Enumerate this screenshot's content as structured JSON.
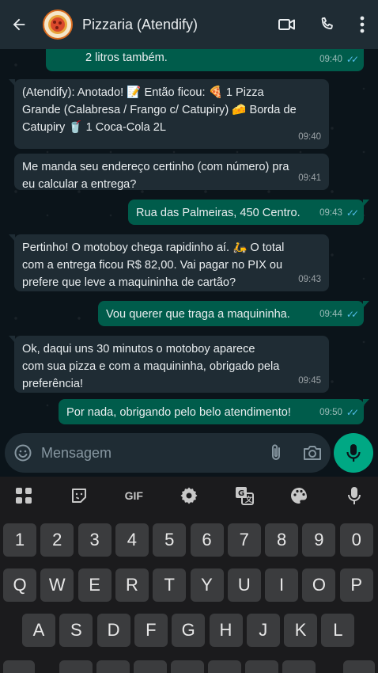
{
  "header": {
    "title": "Pizzaria (Atendify)",
    "back_icon": "arrow-left-icon",
    "video_icon": "video-call-icon",
    "phone_icon": "phone-icon",
    "menu_icon": "more-vertical-icon"
  },
  "messages": [
    {
      "dir": "out",
      "text": "2 litros também.",
      "time": "09:40",
      "read": true
    },
    {
      "dir": "in",
      "lines": [
        "(Atendify): Anotado! 📝 Então ficou: 🍕 1 Pizza",
        "Grande (Calabresa / Frango c/ Catupiry) 🧀 Borda de",
        "Catupiry 🥤 1 Coca-Cola 2L"
      ],
      "time": "09:40"
    },
    {
      "dir": "in",
      "lines": [
        "Me manda seu endereço certinho (com número) pra",
        "eu calcular a entrega?"
      ],
      "time": "09:41"
    },
    {
      "dir": "out",
      "text": "Rua das Palmeiras, 450 Centro.",
      "time": "09:43",
      "read": true
    },
    {
      "dir": "in",
      "lines": [
        "Pertinho! O motoboy chega rapidinho aí. 🛵 O total",
        "com a entrega ficou R$ 82,00. Vai pagar no PIX ou",
        "prefere que leve a maquininha de cartão?"
      ],
      "time": "09:43"
    },
    {
      "dir": "out",
      "text": "Vou querer que traga a maquininha.",
      "time": "09:44",
      "read": true
    },
    {
      "dir": "in",
      "lines": [
        "Ok, daqui uns 30 minutos o motoboy aparece",
        "com sua pizza e com a maquininha, obrigado pela",
        "preferência!"
      ],
      "time": "09:45"
    },
    {
      "dir": "out",
      "text": "Por nada, obrigando pelo belo atendimento!",
      "time": "09:50",
      "read": true
    }
  ],
  "input": {
    "placeholder": "Mensagem",
    "emoji_icon": "emoji-icon",
    "attach_icon": "paperclip-icon",
    "camera_icon": "camera-icon",
    "mic_icon": "mic-icon"
  },
  "keyboard": {
    "toolbar": [
      "apps-grid-icon",
      "sticker-icon",
      "GIF",
      "settings-gear-icon",
      "translate-icon",
      "palette-icon",
      "mic-icon"
    ],
    "gif_label": "GIF",
    "row_numbers": [
      "1",
      "2",
      "3",
      "4",
      "5",
      "6",
      "7",
      "8",
      "9",
      "0"
    ],
    "row_q": [
      "Q",
      "W",
      "E",
      "R",
      "T",
      "Y",
      "U",
      "I",
      "O",
      "P"
    ],
    "row_a": [
      "A",
      "S",
      "D",
      "F",
      "G",
      "H",
      "J",
      "K",
      "L"
    ]
  },
  "colors": {
    "header_bg": "#1f2c34",
    "chat_bg": "#0b141a",
    "incoming_bubble": "#1f2c34",
    "outgoing_bubble": "#005c4b",
    "read_ticks": "#53bdeb",
    "mic_button": "#00a884"
  }
}
